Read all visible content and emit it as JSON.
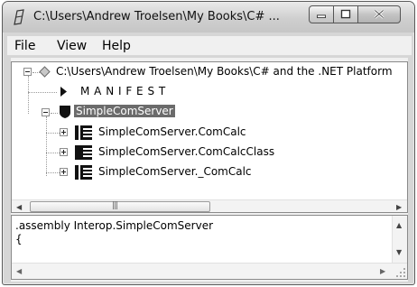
{
  "window": {
    "title": "C:\\Users\\Andrew Troelsen\\My Books\\C# ..."
  },
  "menu": {
    "items": [
      "File",
      "View",
      "Help"
    ]
  },
  "tree": {
    "root_label": "C:\\Users\\Andrew Troelsen\\My Books\\C# and the .NET Platform",
    "manifest_label": "M A N I F E S T",
    "assembly_label": "SimpleComServer",
    "types": [
      "SimpleComServer.ComCalc",
      "SimpleComServer.ComCalcClass",
      "SimpleComServer._ComCalc"
    ]
  },
  "code_view": {
    "lines": [
      ".assembly Interop.SimpleComServer",
      "{"
    ]
  },
  "icons": {
    "app": "ildasm-icon",
    "root": "diamond-icon",
    "manifest": "triangle-icon",
    "namespace": "shield-icon",
    "interface": "interface-icon",
    "class": "class-icon"
  }
}
